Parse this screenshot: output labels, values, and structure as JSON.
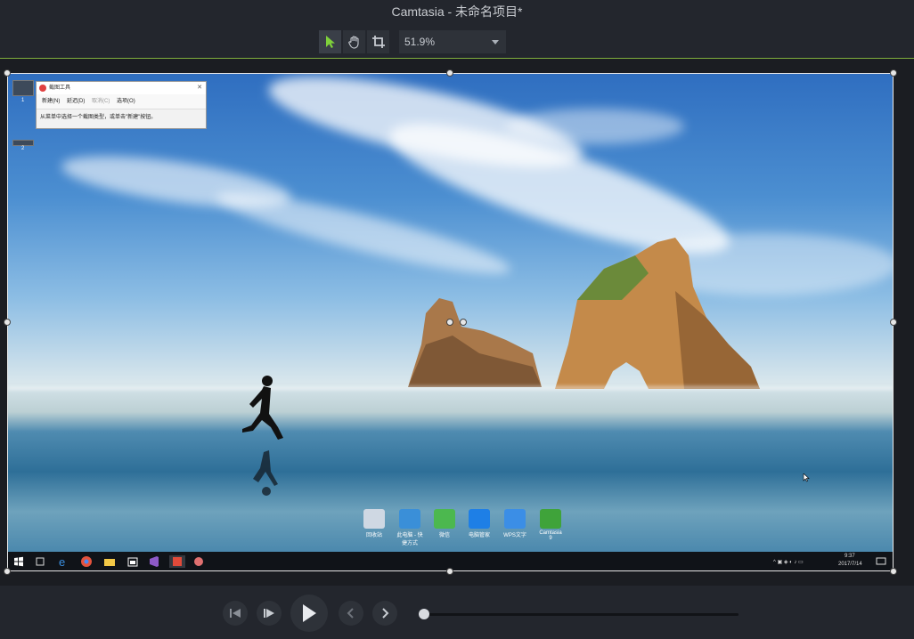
{
  "window": {
    "title": "Camtasia - 未命名项目*"
  },
  "toolbar": {
    "tools": [
      {
        "name": "select-tool",
        "icon": "arrow-pointer-icon",
        "active": true
      },
      {
        "name": "pan-tool",
        "icon": "hand-icon",
        "active": false
      },
      {
        "name": "crop-tool",
        "icon": "crop-icon",
        "active": false
      }
    ],
    "zoom": "51.9%"
  },
  "snipping_tool": {
    "title": "截图工具",
    "new_label": "新建(N)",
    "delay_label": "延迟(D)",
    "cancel_label": "取消(C)",
    "options_label": "选项(O)",
    "message": "从菜单中选择一个截图类型，或单击\"新建\"按钮。"
  },
  "desktop": {
    "icons": [
      {
        "label": "回收站",
        "icon": "recycle-bin-icon",
        "color": "#cfd8e3"
      },
      {
        "label": "此电脑 - 快捷方式",
        "icon": "computer-icon",
        "color": "#3a8fd8"
      },
      {
        "label": "微信",
        "icon": "wechat-icon",
        "color": "#4cb84f"
      },
      {
        "label": "电脑管家",
        "icon": "shield-icon",
        "color": "#1e7fe6"
      },
      {
        "label": "WPS文字",
        "icon": "wps-writer-icon",
        "color": "#3b8ee6"
      },
      {
        "label": "Camtasia 9",
        "icon": "camtasia-icon",
        "color": "#3fa33a"
      }
    ],
    "top_icon_labels": [
      "1",
      "2"
    ]
  },
  "taskbar": {
    "time": "9:37",
    "date": "2017/7/14"
  },
  "colors": {
    "accent_line": "#7fae3c",
    "background": "#23262d"
  }
}
